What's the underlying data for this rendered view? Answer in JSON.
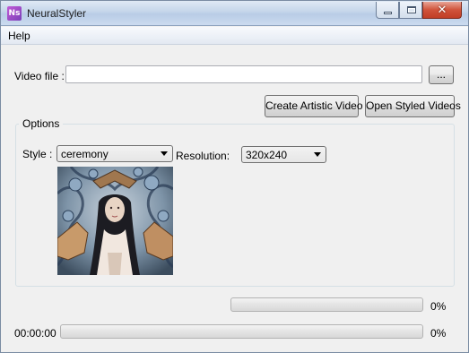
{
  "window": {
    "title": "NeuralStyler",
    "app_icon_text": "Ns",
    "close_glyph": "✕"
  },
  "menu": {
    "help_label": "Help"
  },
  "video": {
    "label": "Video file :",
    "value": "",
    "browse_label": "..."
  },
  "actions": {
    "create_label": "Create Artistic Video",
    "open_label": "Open Styled Videos"
  },
  "options": {
    "group_title": "Options",
    "style_label": "Style :",
    "style_value": "ceremony",
    "resolution_label": "Resolution:",
    "resolution_value": "320x240",
    "preview_icon": "style-preview-image"
  },
  "progress": {
    "top_percent_text": "0%",
    "top_value": 0,
    "time_text": "00:00:00",
    "bottom_percent_text": "0%",
    "bottom_value": 0
  },
  "colors": {
    "accent": "#37c52c",
    "close_button": "#c13e26",
    "window_bg": "#f0f0f0"
  }
}
